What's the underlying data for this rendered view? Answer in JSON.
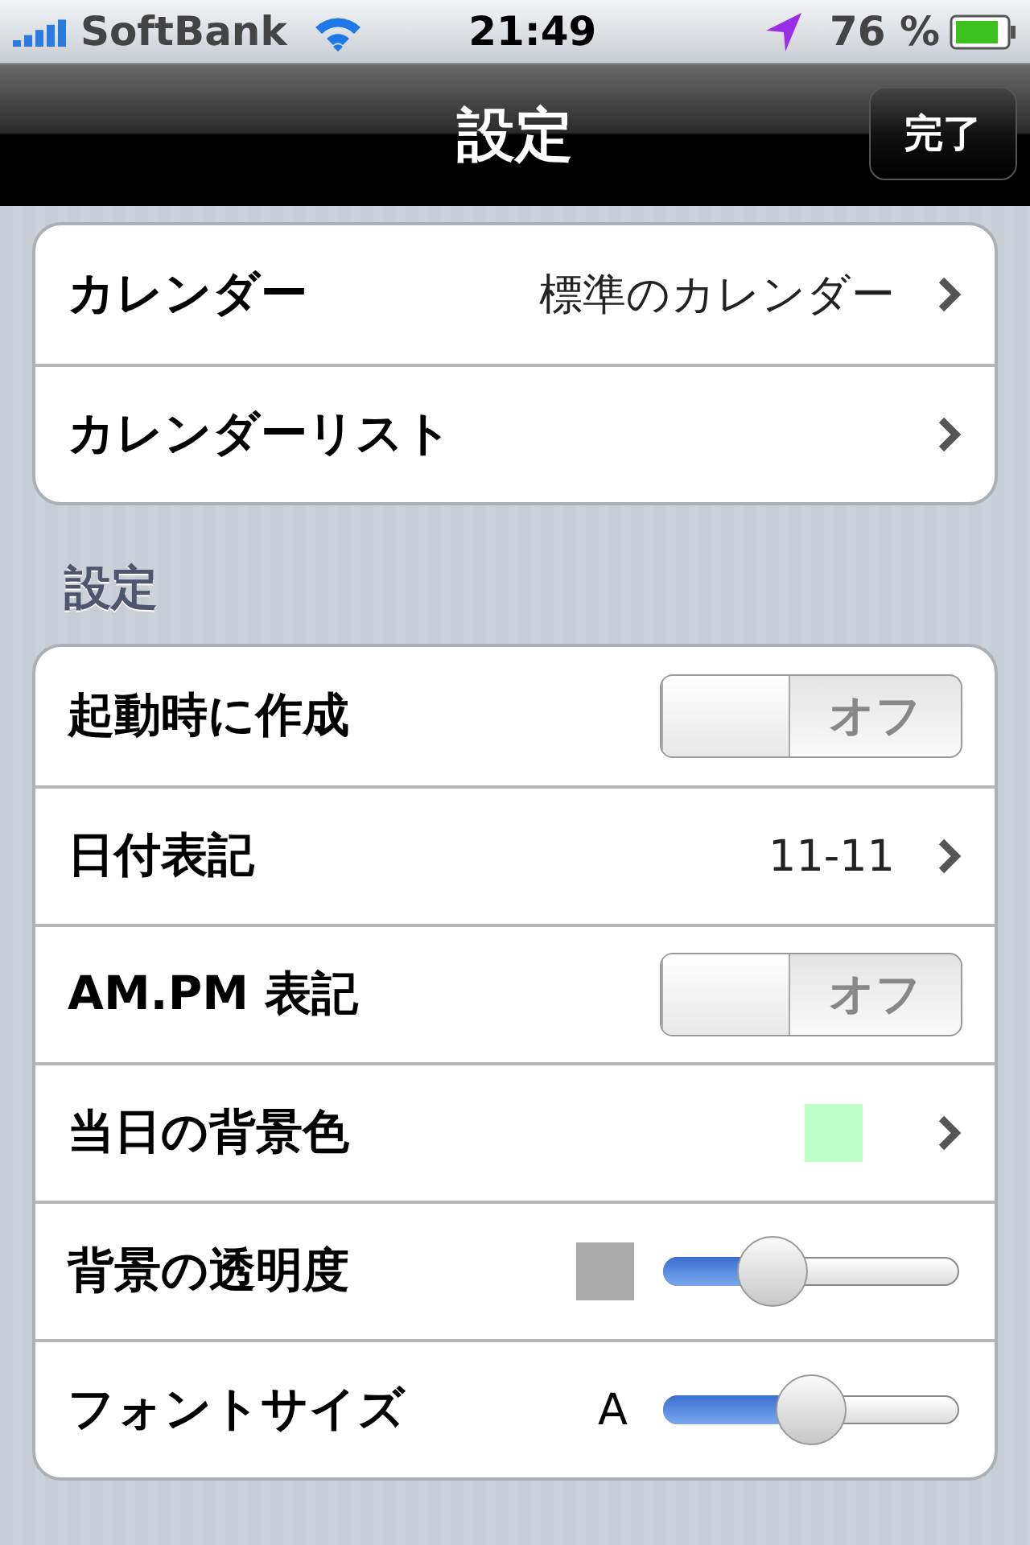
{
  "status_bar": {
    "carrier": "SoftBank",
    "time": "21:49",
    "battery": "76 %"
  },
  "nav_bar": {
    "title": "設定",
    "done_button": "完了"
  },
  "top_group": [
    {
      "kind": "value",
      "label": "カレンダー",
      "value": "標準のカレンダー"
    },
    {
      "kind": "value",
      "label": "カレンダーリスト"
    }
  ],
  "section_header": "設定",
  "settings": [
    {
      "kind": "toggle",
      "label": "起動時に作成",
      "on": false,
      "switch_text": "オフ"
    },
    {
      "kind": "value",
      "label": "日付表記",
      "value": "11-11"
    },
    {
      "kind": "toggle",
      "label": "AM.PM 表記",
      "on": false,
      "switch_text": "オフ"
    },
    {
      "kind": "swatch",
      "label": "当日の背景色",
      "color": "#c0ffc8"
    },
    {
      "kind": "slider",
      "label": "背景の透明度",
      "color": "#aaaaaa",
      "level": 0.37
    },
    {
      "kind": "slider",
      "label": "フォントサイズ",
      "preview_text": "A",
      "level": 0.5
    }
  ]
}
